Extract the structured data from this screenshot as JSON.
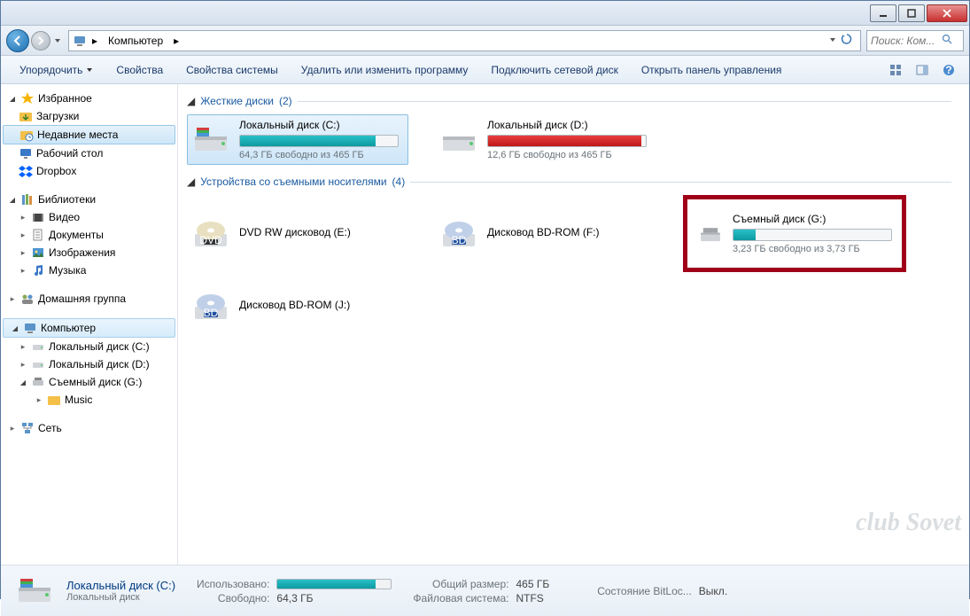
{
  "breadcrumb": {
    "root": "Компьютер"
  },
  "search": {
    "placeholder": "Поиск: Ком..."
  },
  "toolbar": {
    "organize": "Упорядочить",
    "properties": "Свойства",
    "system_props": "Свойства системы",
    "uninstall": "Удалить или изменить программу",
    "map_drive": "Подключить сетевой диск",
    "control_panel": "Открыть панель управления"
  },
  "sidebar": {
    "favorites": "Избранное",
    "downloads": "Загрузки",
    "recent": "Недавние места",
    "desktop": "Рабочий стол",
    "dropbox": "Dropbox",
    "libraries": "Библиотеки",
    "videos": "Видео",
    "documents": "Документы",
    "pictures": "Изображения",
    "music": "Музыка",
    "homegroup": "Домашняя группа",
    "computer": "Компьютер",
    "local_c": "Локальный диск (C:)",
    "local_d": "Локальный диск (D:)",
    "removable_g": "Съемный диск (G:)",
    "music_folder": "Music",
    "network": "Сеть"
  },
  "groups": {
    "hdd": {
      "title": "Жесткие диски",
      "count": "(2)"
    },
    "removable": {
      "title": "Устройства со съемными носителями",
      "count": "(4)"
    }
  },
  "drives": {
    "c": {
      "name": "Локальный диск (C:)",
      "sub": "64,3 ГБ свободно из 465 ГБ",
      "fill_pct": 86,
      "color": "teal"
    },
    "d": {
      "name": "Локальный диск (D:)",
      "sub": "12,6 ГБ свободно из 465 ГБ",
      "fill_pct": 97,
      "color": "red"
    },
    "dvd_e": {
      "name": "DVD RW дисковод (E:)"
    },
    "bd_f": {
      "name": "Дисковод BD-ROM (F:)"
    },
    "g": {
      "name": "Съемный диск (G:)",
      "sub": "3,23 ГБ свободно из 3,73 ГБ",
      "fill_pct": 14,
      "color": "teal"
    },
    "bd_j": {
      "name": "Дисковод BD-ROM (J:)"
    }
  },
  "details": {
    "title": "Локальный диск (C:)",
    "sub": "Локальный диск",
    "used_label": "Использовано:",
    "used_bar_pct": 86,
    "free_label": "Свободно:",
    "free_val": "64,3 ГБ",
    "total_label": "Общий размер:",
    "total_val": "465 ГБ",
    "fs_label": "Файловая система:",
    "fs_val": "NTFS",
    "bitlocker_label": "Состояние BitLoc...",
    "bitlocker_val": "Выкл."
  },
  "watermark": "club Sovet"
}
